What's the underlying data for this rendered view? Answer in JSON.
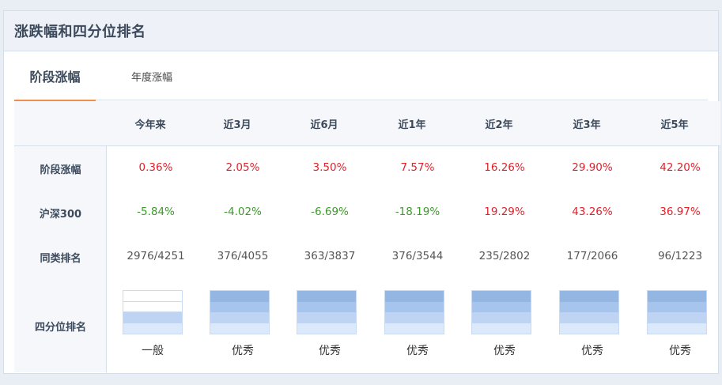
{
  "panel": {
    "title": "涨跌幅和四分位排名"
  },
  "tabs": [
    {
      "label": "阶段涨幅",
      "active": true
    },
    {
      "label": "年度涨幅",
      "active": false
    }
  ],
  "columns": [
    "今年来",
    "近3月",
    "近6月",
    "近1年",
    "近2年",
    "近3年",
    "近5年"
  ],
  "rows": {
    "stage": {
      "label": "阶段涨幅",
      "values": [
        "0.36%",
        "2.05%",
        "3.50%",
        "7.57%",
        "16.26%",
        "29.90%",
        "42.20%"
      ]
    },
    "hs300": {
      "label": "沪深300",
      "values": [
        "-5.84%",
        "-4.02%",
        "-6.69%",
        "-18.19%",
        "19.29%",
        "43.26%",
        "36.97%"
      ]
    },
    "rank": {
      "label": "同类排名",
      "values": [
        "2976/4251",
        "376/4055",
        "363/3837",
        "376/3544",
        "235/2802",
        "177/2066",
        "96/1223"
      ]
    },
    "quartile": {
      "label": "四分位排名",
      "levels": [
        2,
        4,
        4,
        4,
        4,
        4,
        4
      ],
      "texts": [
        "一般",
        "优秀",
        "优秀",
        "优秀",
        "优秀",
        "优秀",
        "优秀"
      ]
    }
  },
  "colors": {
    "up": "#e0222b",
    "down": "#3e9a2d",
    "accent": "#ef8f4c",
    "quartile_fill": "#94b6e3"
  }
}
